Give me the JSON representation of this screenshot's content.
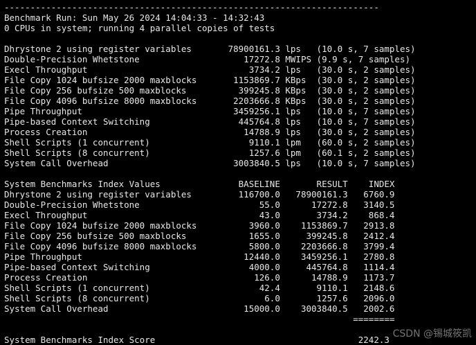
{
  "colors": {
    "background": "#000000",
    "text": "#e8e8e8"
  },
  "header": {
    "rule": "------------------------------------------------------------------------",
    "run_line": "Benchmark Run: Sun May 26 2024 14:04:33 - 14:32:43",
    "cpu_line": "0 CPUs in system; running 4 parallel copies of tests"
  },
  "results": [
    "Dhrystone 2 using register variables       78900161.3 lps   (10.0 s, 7 samples)",
    "Double-Precision Whetstone                    17272.8 MWIPS (9.9 s, 7 samples)",
    "Execl Throughput                               3734.2 lps   (30.0 s, 2 samples)",
    "File Copy 1024 bufsize 2000 maxblocks       1153869.7 KBps  (30.0 s, 2 samples)",
    "File Copy 256 bufsize 500 maxblocks          399245.8 KBps  (30.0 s, 2 samples)",
    "File Copy 4096 bufsize 8000 maxblocks       2203666.8 KBps  (30.0 s, 2 samples)",
    "Pipe Throughput                             3459256.1 lps   (10.0 s, 7 samples)",
    "Pipe-based Context Switching                 445764.8 lps   (10.0 s, 7 samples)",
    "Process Creation                              14788.9 lps   (30.0 s, 2 samples)",
    "Shell Scripts (1 concurrent)                   9110.1 lpm   (60.0 s, 2 samples)",
    "Shell Scripts (8 concurrent)                   1257.6 lpm   (60.1 s, 2 samples)",
    "System Call Overhead                        3003840.5 lps   (10.0 s, 7 samples)"
  ],
  "index_header": "System Benchmarks Index Values               BASELINE       RESULT    INDEX",
  "index_rows": [
    "Dhrystone 2 using register variables         116700.0   78900161.3   6760.9",
    "Double-Precision Whetstone                       55.0      17272.8   3140.5",
    "Execl Throughput                                 43.0       3734.2    868.4",
    "File Copy 1024 bufsize 2000 maxblocks          3960.0    1153869.7   2913.8",
    "File Copy 256 bufsize 500 maxblocks            1655.0     399245.8   2412.4",
    "File Copy 4096 bufsize 8000 maxblocks          5800.0    2203666.8   3799.4",
    "Pipe Throughput                               12440.0    3459256.1   2780.8",
    "Pipe-based Context Switching                   4000.0     445764.8   1114.4",
    "Process Creation                                126.0      14788.9   1173.7",
    "Shell Scripts (1 concurrent)                     42.4       9110.1   2148.6",
    "Shell Scripts (8 concurrent)                      6.0       1257.6   2096.0",
    "System Call Overhead                          15000.0    3003840.5   2002.6"
  ],
  "score_rule": "                                                                   ========",
  "score_line": "System Benchmarks Index Score                                       2242.3",
  "watermark": "CSDN @锡城筱凯"
}
